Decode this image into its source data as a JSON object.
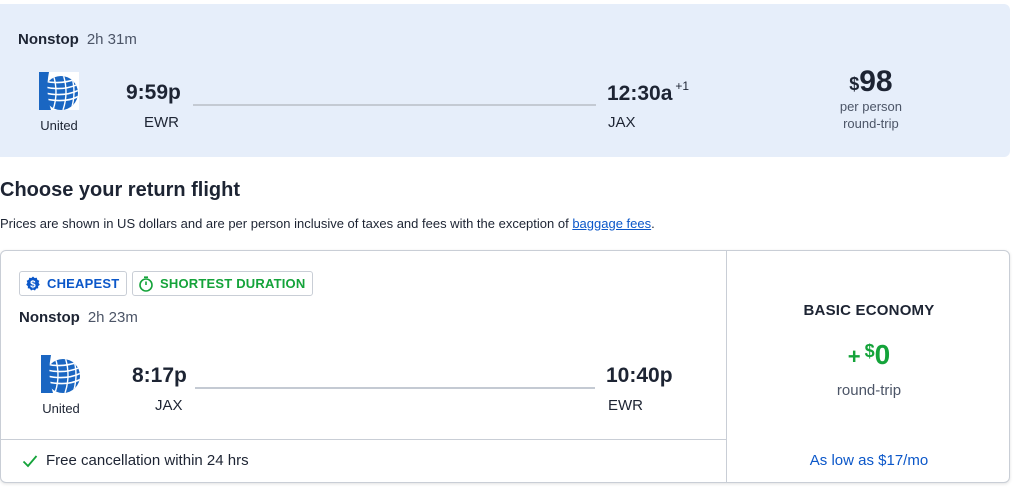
{
  "outbound": {
    "stops": "Nonstop",
    "duration": "2h 31m",
    "airline": "United",
    "depart_time": "9:59p",
    "depart_airport": "EWR",
    "arrive_time": "12:30a",
    "day_offset": "+1",
    "arrive_airport": "JAX",
    "price_currency": "$",
    "price": "98",
    "price_sub1": "per person",
    "price_sub2": "round-trip"
  },
  "return_section": {
    "heading": "Choose your return flight",
    "disclaimer": "Prices are shown in US dollars and are per person inclusive of taxes and fees with the exception of ",
    "disclaimer_link": "baggage fees",
    "disclaimer_end": "."
  },
  "option": {
    "badges": {
      "cheapest": "CHEAPEST",
      "shortest": "SHORTEST DURATION"
    },
    "stops": "Nonstop",
    "duration": "2h 23m",
    "airline": "United",
    "depart_time": "8:17p",
    "depart_airport": "JAX",
    "arrive_time": "10:40p",
    "arrive_airport": "EWR",
    "cancellation": "Free cancellation within 24 hrs",
    "fare_type": "BASIC ECONOMY",
    "fare_plus": "+",
    "fare_currency": "$",
    "fare_amount": "0",
    "fare_sub": "round-trip",
    "financing": "As low as $17/mo"
  },
  "colors": {
    "accent_blue": "#0b57c9",
    "success_green": "#14a33a",
    "selected_bg": "#e6eefa",
    "united_logo_blue": "#1a66c2"
  },
  "icons": {
    "airline_logo": "united-globe-logo",
    "cheapest_badge": "dollar-circle-icon",
    "shortest_badge": "stopwatch-icon",
    "cancellation": "checkmark-icon"
  }
}
